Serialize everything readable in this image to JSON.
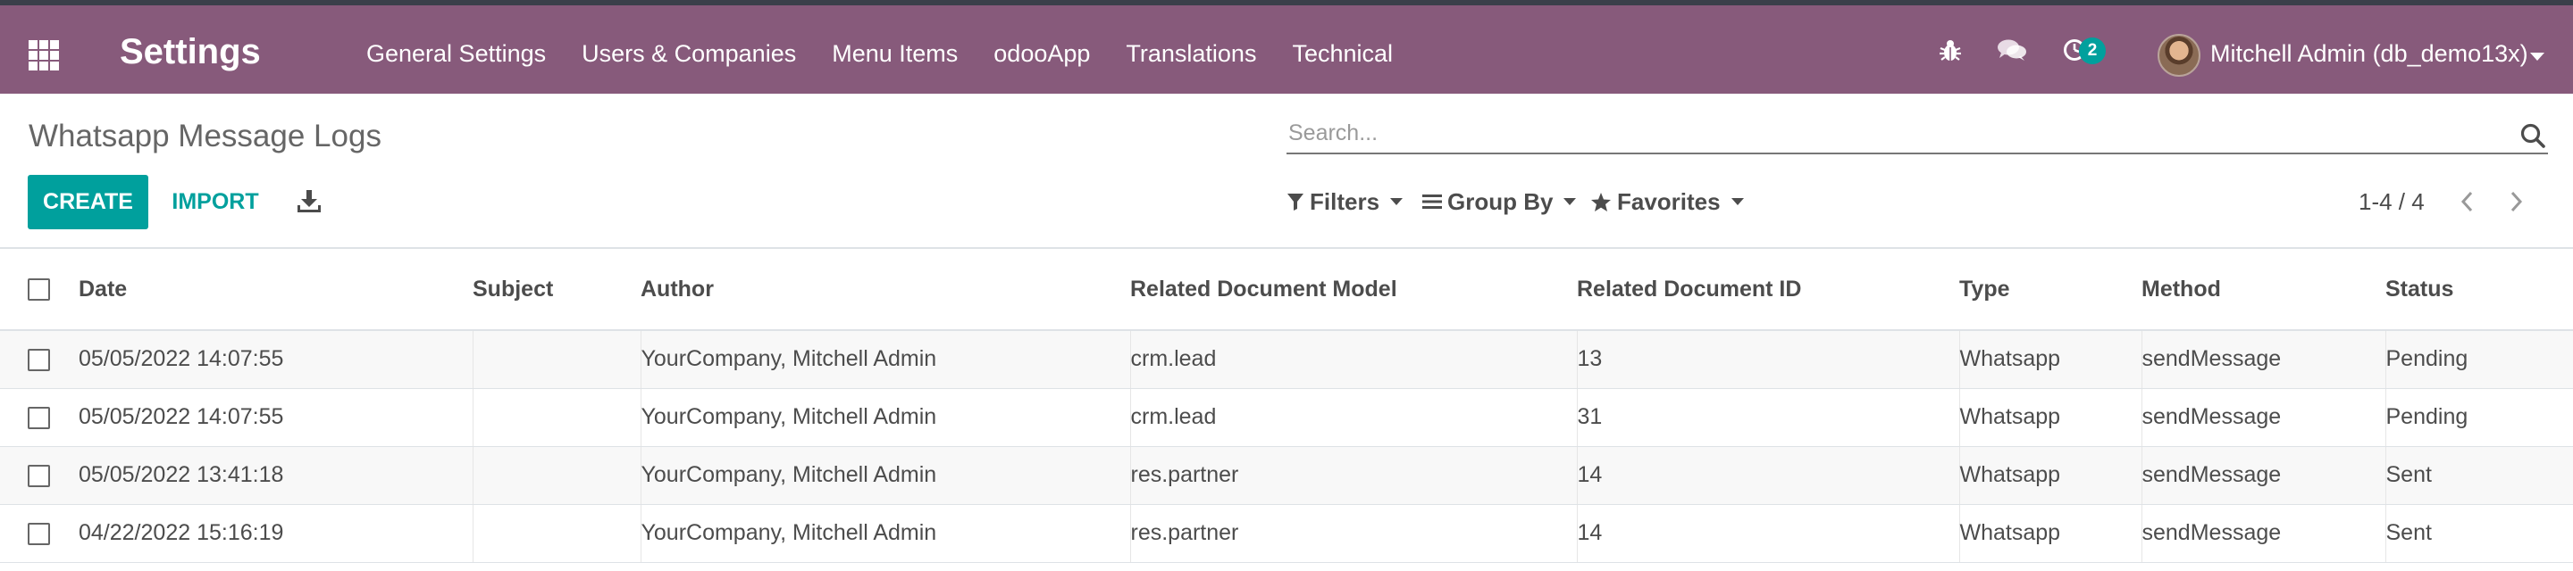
{
  "navbar": {
    "app_title": "Settings",
    "menu": [
      "General Settings",
      "Users & Companies",
      "Menu Items",
      "odooApp",
      "Translations",
      "Technical"
    ],
    "activity_count": "2",
    "user_name": "Mitchell Admin (db_demo13x)",
    "background_color": "#875a7b"
  },
  "control_panel": {
    "page_title": "Whatsapp Message Logs",
    "search_placeholder": "Search...",
    "create_label": "CREATE",
    "import_label": "IMPORT",
    "filters_label": "Filters",
    "group_by_label": "Group By",
    "favorites_label": "Favorites",
    "pager": "1-4 / 4",
    "accent_color": "#00a09d"
  },
  "table": {
    "columns": [
      "Date",
      "Subject",
      "Author",
      "Related Document Model",
      "Related Document ID",
      "Type",
      "Method",
      "Status"
    ],
    "rows": [
      [
        "05/05/2022 14:07:55",
        "",
        "YourCompany, Mitchell Admin",
        "crm.lead",
        "13",
        "Whatsapp",
        "sendMessage",
        "Pending"
      ],
      [
        "05/05/2022 14:07:55",
        "",
        "YourCompany, Mitchell Admin",
        "crm.lead",
        "31",
        "Whatsapp",
        "sendMessage",
        "Pending"
      ],
      [
        "05/05/2022 13:41:18",
        "",
        "YourCompany, Mitchell Admin",
        "res.partner",
        "14",
        "Whatsapp",
        "sendMessage",
        "Sent"
      ],
      [
        "04/22/2022 15:16:19",
        "",
        "YourCompany, Mitchell Admin",
        "res.partner",
        "14",
        "Whatsapp",
        "sendMessage",
        "Sent"
      ]
    ]
  },
  "icons": {
    "apps": "apps-grid-icon",
    "debug": "bug-icon",
    "messages": "chat-icon",
    "activities": "clock-icon",
    "search": "search-icon",
    "download": "download-icon",
    "filters": "filter-icon",
    "group_by": "bars-icon",
    "favorites": "star-icon"
  }
}
